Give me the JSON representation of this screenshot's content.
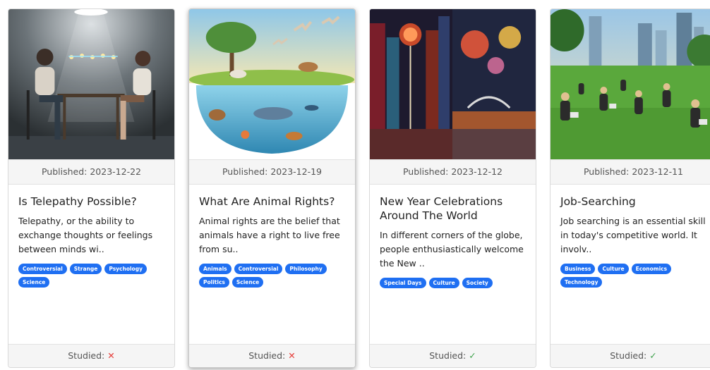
{
  "articles": [
    {
      "image_icon": "telepathy-illustration",
      "published": "Published: 2023-12-22",
      "title": "Is Telepathy Possible?",
      "excerpt": "Telepathy, or the ability to exchange thoughts or feelings between minds wi..",
      "tags": [
        "Controversial",
        "Strange",
        "Psychology",
        "Science"
      ],
      "studied_label": "Studied:",
      "studied": false,
      "studied_mark": "✕"
    },
    {
      "image_icon": "animal-rights-illustration",
      "published": "Published: 2023-12-19",
      "title": "What Are Animal Rights?",
      "excerpt": "Animal rights are the belief that animals have a right to live free from su..",
      "tags": [
        "Animals",
        "Controversial",
        "Philosophy",
        "Politics",
        "Science"
      ],
      "studied_label": "Studied:",
      "studied": false,
      "studied_mark": "✕"
    },
    {
      "image_icon": "new-year-celebrations-illustration",
      "published": "Published: 2023-12-12",
      "title": "New Year Celebrations Around The World",
      "excerpt": "In different corners of the globe, people enthusiastically welcome the New ..",
      "tags": [
        "Special Days",
        "Culture",
        "Society"
      ],
      "studied_label": "Studied:",
      "studied": true,
      "studied_mark": "✓"
    },
    {
      "image_icon": "job-searching-illustration",
      "published": "Published: 2023-12-11",
      "title": "Job-Searching",
      "excerpt": "Job searching is an essential skill in today's competitive world. It involv..",
      "tags": [
        "Business",
        "Culture",
        "Economics",
        "Technology"
      ],
      "studied_label": "Studied:",
      "studied": true,
      "studied_mark": "✓"
    }
  ],
  "colors": {
    "tag": "#1f6ff2",
    "not_studied": "#e53935",
    "studied": "#3fa34d"
  }
}
